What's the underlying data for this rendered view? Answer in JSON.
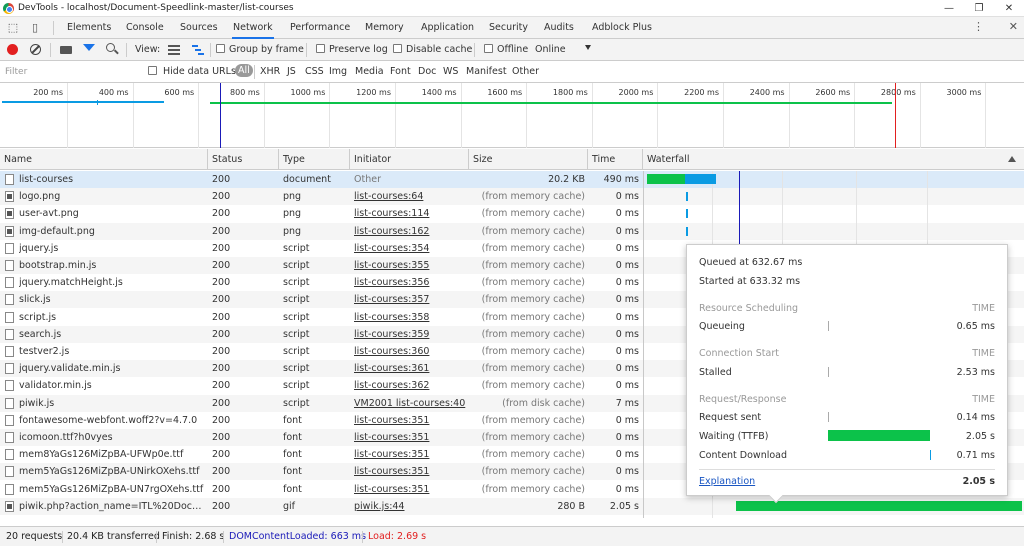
{
  "window": {
    "title": "DevTools - localhost/Document-Speedlink-master/list-courses"
  },
  "tabs": [
    "Elements",
    "Console",
    "Sources",
    "Network",
    "Performance",
    "Memory",
    "Application",
    "Security",
    "Audits",
    "Adblock Plus"
  ],
  "active_tab": "Network",
  "toolbar": {
    "view_label": "View:",
    "group_by_frame": "Group by frame",
    "preserve_log": "Preserve log",
    "disable_cache": "Disable cache",
    "offline": "Offline",
    "throttle": "Online"
  },
  "filterbar": {
    "placeholder": "Filter",
    "hide_data_urls": "Hide data URLs",
    "types": [
      "All",
      "XHR",
      "JS",
      "CSS",
      "Img",
      "Media",
      "Font",
      "Doc",
      "WS",
      "Manifest",
      "Other"
    ]
  },
  "timeline": {
    "ticks": [
      "200 ms",
      "400 ms",
      "600 ms",
      "800 ms",
      "1000 ms",
      "1200 ms",
      "1400 ms",
      "1600 ms",
      "1800 ms",
      "2000 ms",
      "2200 ms",
      "2400 ms",
      "2600 ms",
      "2800 ms",
      "3000 ms"
    ]
  },
  "columns": {
    "name": "Name",
    "status": "Status",
    "type": "Type",
    "initiator": "Initiator",
    "size": "Size",
    "time": "Time",
    "waterfall": "Waterfall"
  },
  "rows": [
    {
      "name": "list-courses",
      "status": "200",
      "type": "document",
      "initiator": "Other",
      "size": "20.2 KB",
      "time": "490 ms"
    },
    {
      "name": "logo.png",
      "status": "200",
      "type": "png",
      "initiator": "list-courses:64",
      "size": "(from memory cache)",
      "time": "0 ms"
    },
    {
      "name": "user-avt.png",
      "status": "200",
      "type": "png",
      "initiator": "list-courses:114",
      "size": "(from memory cache)",
      "time": "0 ms"
    },
    {
      "name": "img-default.png",
      "status": "200",
      "type": "png",
      "initiator": "list-courses:162",
      "size": "(from memory cache)",
      "time": "0 ms"
    },
    {
      "name": "jquery.js",
      "status": "200",
      "type": "script",
      "initiator": "list-courses:354",
      "size": "(from memory cache)",
      "time": "0 ms"
    },
    {
      "name": "bootstrap.min.js",
      "status": "200",
      "type": "script",
      "initiator": "list-courses:355",
      "size": "(from memory cache)",
      "time": "0 ms"
    },
    {
      "name": "jquery.matchHeight.js",
      "status": "200",
      "type": "script",
      "initiator": "list-courses:356",
      "size": "(from memory cache)",
      "time": "0 ms"
    },
    {
      "name": "slick.js",
      "status": "200",
      "type": "script",
      "initiator": "list-courses:357",
      "size": "(from memory cache)",
      "time": "0 ms"
    },
    {
      "name": "script.js",
      "status": "200",
      "type": "script",
      "initiator": "list-courses:358",
      "size": "(from memory cache)",
      "time": "0 ms"
    },
    {
      "name": "search.js",
      "status": "200",
      "type": "script",
      "initiator": "list-courses:359",
      "size": "(from memory cache)",
      "time": "0 ms"
    },
    {
      "name": "testver2.js",
      "status": "200",
      "type": "script",
      "initiator": "list-courses:360",
      "size": "(from memory cache)",
      "time": "0 ms"
    },
    {
      "name": "jquery.validate.min.js",
      "status": "200",
      "type": "script",
      "initiator": "list-courses:361",
      "size": "(from memory cache)",
      "time": "0 ms"
    },
    {
      "name": "validator.min.js",
      "status": "200",
      "type": "script",
      "initiator": "list-courses:362",
      "size": "(from memory cache)",
      "time": "0 ms"
    },
    {
      "name": "piwik.js",
      "status": "200",
      "type": "script",
      "initiator": "VM2001 list-courses:40",
      "size": "(from disk cache)",
      "time": "7 ms"
    },
    {
      "name": "fontawesome-webfont.woff2?v=4.7.0",
      "status": "200",
      "type": "font",
      "initiator": "list-courses:351",
      "size": "(from memory cache)",
      "time": "0 ms"
    },
    {
      "name": "icomoon.ttf?h0vyes",
      "status": "200",
      "type": "font",
      "initiator": "list-courses:351",
      "size": "(from memory cache)",
      "time": "0 ms"
    },
    {
      "name": "mem8YaGs126MiZpBA-UFWp0e.ttf",
      "status": "200",
      "type": "font",
      "initiator": "list-courses:351",
      "size": "(from memory cache)",
      "time": "0 ms"
    },
    {
      "name": "mem5YaGs126MiZpBA-UNirkOXehs.ttf",
      "status": "200",
      "type": "font",
      "initiator": "list-courses:351",
      "size": "(from memory cache)",
      "time": "0 ms"
    },
    {
      "name": "mem5YaGs126MiZpBA-UN7rgOXehs.ttf",
      "status": "200",
      "type": "font",
      "initiator": "list-courses:351",
      "size": "(from memory cache)",
      "time": "0 ms"
    },
    {
      "name": "piwik.php?action_name=ITL%20Docume...",
      "status": "200",
      "type": "gif",
      "initiator": "piwik.js:44",
      "size": "280 B",
      "time": "2.05 s"
    }
  ],
  "popover": {
    "queued": "Queued at 632.67 ms",
    "started": "Started at 633.32 ms",
    "resource_scheduling": "Resource Scheduling",
    "time_header": "TIME",
    "queueing": "Queueing",
    "queueing_val": "0.65 ms",
    "connection_start": "Connection Start",
    "stalled": "Stalled",
    "stalled_val": "2.53 ms",
    "request_response": "Request/Response",
    "request_sent": "Request sent",
    "request_sent_val": "0.14 ms",
    "waiting": "Waiting (TTFB)",
    "waiting_val": "2.05 s",
    "content_download": "Content Download",
    "content_download_val": "0.71 ms",
    "explanation": "Explanation",
    "total": "2.05 s"
  },
  "status": {
    "requests": "20 requests",
    "transferred": "20.4 KB transferred",
    "finish": "Finish: 2.68 s",
    "domcontentloaded": "DOMContentLoaded: 663 ms",
    "load": "Load: 2.69 s"
  },
  "colors": {
    "accent": "#1a73e8",
    "green": "#0cc24a",
    "blue_bar": "#0a9be3",
    "red_load": "#e21f1f",
    "dcl_blue": "#1a1ab8"
  }
}
